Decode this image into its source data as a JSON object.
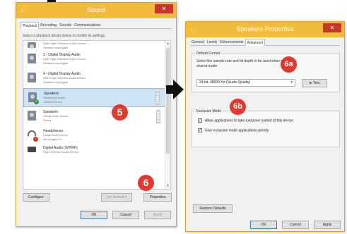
{
  "sound_dialog": {
    "title": "Sound",
    "tabs": [
      "Playback",
      "Recording",
      "Sounds",
      "Communications"
    ],
    "instruction": "Select a playback device below to modify its settings:",
    "devices": [
      {
        "name": "",
        "desc": "AMD High Definition Audio Device",
        "status": "Disabled unplugged",
        "icon": "speaker-icon",
        "partial": true
      },
      {
        "name": "3 - Digital Display Audio",
        "desc": "AMD High Definition Audio Device",
        "status": "Disabled unplugged",
        "icon": "speaker-icon"
      },
      {
        "name": "4 - Digital Display Audio",
        "desc": "AMD High Definition Audio Device",
        "status": "Disabled unplugged",
        "icon": "speaker-icon"
      },
      {
        "name": "Speakers",
        "desc": "Realtek(R) Audio",
        "status": "Default Device",
        "icon": "speaker-icon",
        "selected": true
      },
      {
        "name": "Speakers",
        "desc": "Virtual Audio Device",
        "status": "Ready",
        "icon": "speaker-icon"
      },
      {
        "name": "Headphones",
        "desc": "Virtual Audio Device",
        "status": "Not plugged in",
        "icon": "headphones-icon"
      },
      {
        "name": "Digital Audio (S/PDIF)",
        "desc": "High Definition Audio Device",
        "status": "",
        "icon": "spdif-icon",
        "partial": true
      }
    ],
    "buttons": {
      "configure": "Configure",
      "set_default": "Set Default",
      "properties": "Properties",
      "ok": "OK",
      "cancel": "Cancel",
      "apply": "Apply"
    }
  },
  "props_dialog": {
    "title": "Speakers Properties",
    "tabs": [
      "General",
      "Levels",
      "Enhancements",
      "Advanced"
    ],
    "default_format": {
      "title": "Default Format",
      "description": "Select the sample rate and bit depth to be used when running in shared mode.",
      "selected": "24 bit, 48000 Hz (Studio Quality)",
      "test": "Test"
    },
    "exclusive_mode": {
      "title": "Exclusive Mode",
      "allow_label": "Allow applications to take exclusive control of this device",
      "priority_label": "Give exclusive mode applications priority"
    },
    "restore_defaults": "Restore Defaults",
    "buttons": {
      "ok": "OK",
      "cancel": "Cancel",
      "apply": "Apply"
    }
  },
  "markers": {
    "m5": "5",
    "m6": "6",
    "m6a": "6a",
    "m6b": "6b"
  },
  "colors": {
    "titlebar": "#f2bb3c",
    "marker": "#e03a2f",
    "selection": "#cde4f7",
    "close": "#c7352b"
  }
}
